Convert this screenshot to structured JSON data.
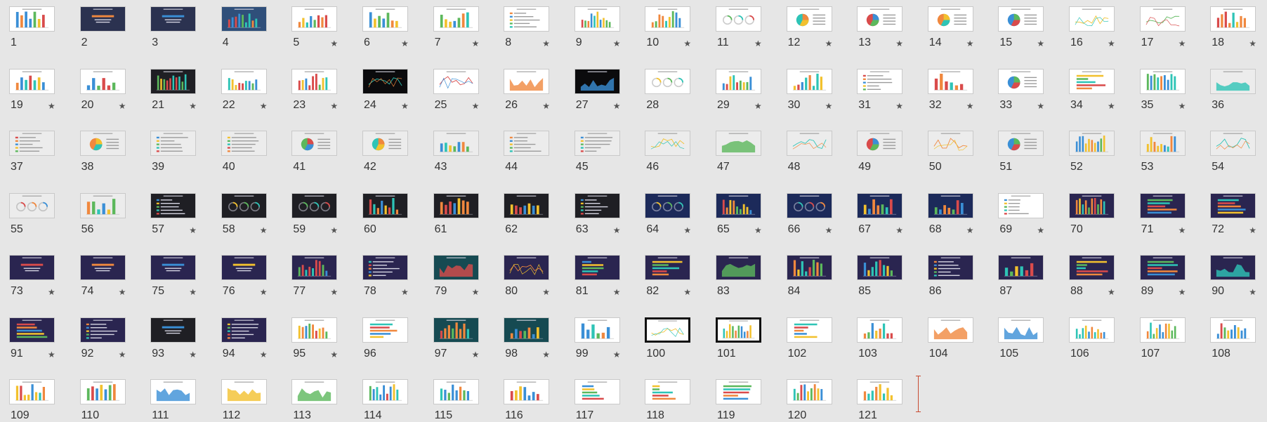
{
  "window": {
    "view": "Slide Sorter"
  },
  "theme_colors": {
    "light_bg": "#ffffff",
    "gray_bg": "#ececec",
    "dark_bg": "#1f1f24",
    "navy_bg": "#2b3250",
    "purple_bg": "#2a2550",
    "teal_bg": "#164a52",
    "accent_red": "#d94b4b",
    "accent_orange": "#f0883e",
    "accent_blue": "#3a8fd6",
    "accent_yellow": "#f2c12e",
    "accent_green": "#5cb85c",
    "accent_teal": "#2ec4b6"
  },
  "slides": [
    {
      "number": "1",
      "star": false,
      "bg": "light",
      "kind": "bars"
    },
    {
      "number": "2",
      "star": false,
      "bg": "navy",
      "kind": "title"
    },
    {
      "number": "3",
      "star": false,
      "bg": "navy",
      "kind": "title"
    },
    {
      "number": "4",
      "star": false,
      "bg": "blue",
      "kind": "bars"
    },
    {
      "number": "5",
      "star": true,
      "bg": "light",
      "kind": "bars"
    },
    {
      "number": "6",
      "star": true,
      "bg": "light",
      "kind": "bars"
    },
    {
      "number": "7",
      "star": true,
      "bg": "light",
      "kind": "bars"
    },
    {
      "number": "8",
      "star": true,
      "bg": "light",
      "kind": "list"
    },
    {
      "number": "9",
      "star": true,
      "bg": "light",
      "kind": "bars"
    },
    {
      "number": "10",
      "star": true,
      "bg": "light",
      "kind": "bars"
    },
    {
      "number": "11",
      "star": true,
      "bg": "light",
      "kind": "rings"
    },
    {
      "number": "12",
      "star": true,
      "bg": "light",
      "kind": "pie"
    },
    {
      "number": "13",
      "star": true,
      "bg": "light",
      "kind": "pie"
    },
    {
      "number": "14",
      "star": true,
      "bg": "light",
      "kind": "pie"
    },
    {
      "number": "15",
      "star": true,
      "bg": "light",
      "kind": "pie"
    },
    {
      "number": "16",
      "star": true,
      "bg": "light",
      "kind": "line"
    },
    {
      "number": "17",
      "star": true,
      "bg": "light",
      "kind": "line"
    },
    {
      "number": "18",
      "star": true,
      "bg": "light",
      "kind": "bars"
    },
    {
      "number": "19",
      "star": true,
      "bg": "light",
      "kind": "bars"
    },
    {
      "number": "20",
      "star": true,
      "bg": "light",
      "kind": "bars"
    },
    {
      "number": "21",
      "star": true,
      "bg": "dark",
      "kind": "bars"
    },
    {
      "number": "22",
      "star": true,
      "bg": "light",
      "kind": "bars"
    },
    {
      "number": "23",
      "star": true,
      "bg": "light",
      "kind": "bars"
    },
    {
      "number": "24",
      "star": true,
      "bg": "black",
      "kind": "line"
    },
    {
      "number": "25",
      "star": true,
      "bg": "light",
      "kind": "line"
    },
    {
      "number": "26",
      "star": true,
      "bg": "light",
      "kind": "area"
    },
    {
      "number": "27",
      "star": true,
      "bg": "black",
      "kind": "area"
    },
    {
      "number": "28",
      "star": false,
      "bg": "light",
      "kind": "rings"
    },
    {
      "number": "29",
      "star": true,
      "bg": "light",
      "kind": "bars"
    },
    {
      "number": "30",
      "star": true,
      "bg": "light",
      "kind": "bars"
    },
    {
      "number": "31",
      "star": true,
      "bg": "light",
      "kind": "list"
    },
    {
      "number": "32",
      "star": true,
      "bg": "light",
      "kind": "bars"
    },
    {
      "number": "33",
      "star": true,
      "bg": "light",
      "kind": "pie"
    },
    {
      "number": "34",
      "star": true,
      "bg": "light",
      "kind": "hbars"
    },
    {
      "number": "35",
      "star": true,
      "bg": "light",
      "kind": "bars"
    },
    {
      "number": "36",
      "star": false,
      "bg": "gray",
      "kind": "area"
    },
    {
      "number": "37",
      "star": false,
      "bg": "gray",
      "kind": "list"
    },
    {
      "number": "38",
      "star": false,
      "bg": "gray",
      "kind": "pie"
    },
    {
      "number": "39",
      "star": false,
      "bg": "gray",
      "kind": "list"
    },
    {
      "number": "40",
      "star": false,
      "bg": "gray",
      "kind": "list"
    },
    {
      "number": "41",
      "star": false,
      "bg": "gray",
      "kind": "pie"
    },
    {
      "number": "42",
      "star": false,
      "bg": "gray",
      "kind": "pie"
    },
    {
      "number": "43",
      "star": false,
      "bg": "gray",
      "kind": "bars"
    },
    {
      "number": "44",
      "star": false,
      "bg": "gray",
      "kind": "list"
    },
    {
      "number": "45",
      "star": false,
      "bg": "gray",
      "kind": "list"
    },
    {
      "number": "46",
      "star": false,
      "bg": "gray",
      "kind": "line"
    },
    {
      "number": "47",
      "star": false,
      "bg": "gray",
      "kind": "area"
    },
    {
      "number": "48",
      "star": false,
      "bg": "gray",
      "kind": "line"
    },
    {
      "number": "49",
      "star": false,
      "bg": "gray",
      "kind": "pie"
    },
    {
      "number": "50",
      "star": false,
      "bg": "gray",
      "kind": "line"
    },
    {
      "number": "51",
      "star": false,
      "bg": "gray",
      "kind": "pie"
    },
    {
      "number": "52",
      "star": false,
      "bg": "gray",
      "kind": "bars"
    },
    {
      "number": "53",
      "star": false,
      "bg": "gray",
      "kind": "bars"
    },
    {
      "number": "54",
      "star": false,
      "bg": "gray",
      "kind": "line"
    },
    {
      "number": "55",
      "star": false,
      "bg": "gray",
      "kind": "rings"
    },
    {
      "number": "56",
      "star": false,
      "bg": "gray",
      "kind": "bars"
    },
    {
      "number": "57",
      "star": true,
      "bg": "dark",
      "kind": "list"
    },
    {
      "number": "58",
      "star": true,
      "bg": "dark",
      "kind": "rings"
    },
    {
      "number": "59",
      "star": true,
      "bg": "dark",
      "kind": "rings"
    },
    {
      "number": "60",
      "star": false,
      "bg": "dark",
      "kind": "bars"
    },
    {
      "number": "61",
      "star": false,
      "bg": "dark",
      "kind": "bars"
    },
    {
      "number": "62",
      "star": false,
      "bg": "dark",
      "kind": "bars"
    },
    {
      "number": "63",
      "star": true,
      "bg": "dark",
      "kind": "list"
    },
    {
      "number": "64",
      "star": true,
      "bg": "space",
      "kind": "rings"
    },
    {
      "number": "65",
      "star": true,
      "bg": "space",
      "kind": "bars"
    },
    {
      "number": "66",
      "star": true,
      "bg": "space",
      "kind": "rings"
    },
    {
      "number": "67",
      "star": true,
      "bg": "space",
      "kind": "bars"
    },
    {
      "number": "68",
      "star": true,
      "bg": "space",
      "kind": "bars"
    },
    {
      "number": "69",
      "star": true,
      "bg": "light",
      "kind": "list"
    },
    {
      "number": "70",
      "star": false,
      "bg": "purple",
      "kind": "bars"
    },
    {
      "number": "71",
      "star": true,
      "bg": "purple",
      "kind": "hbars"
    },
    {
      "number": "72",
      "star": true,
      "bg": "purple",
      "kind": "hbars"
    },
    {
      "number": "73",
      "star": true,
      "bg": "purple",
      "kind": "title"
    },
    {
      "number": "74",
      "star": true,
      "bg": "purple",
      "kind": "title"
    },
    {
      "number": "75",
      "star": true,
      "bg": "purple",
      "kind": "title"
    },
    {
      "number": "76",
      "star": true,
      "bg": "purple",
      "kind": "title"
    },
    {
      "number": "77",
      "star": true,
      "bg": "purple",
      "kind": "bars"
    },
    {
      "number": "78",
      "star": true,
      "bg": "purple",
      "kind": "list"
    },
    {
      "number": "79",
      "star": true,
      "bg": "teal",
      "kind": "area"
    },
    {
      "number": "80",
      "star": true,
      "bg": "purple",
      "kind": "line"
    },
    {
      "number": "81",
      "star": true,
      "bg": "purple",
      "kind": "hbars"
    },
    {
      "number": "82",
      "star": true,
      "bg": "purple",
      "kind": "hbars"
    },
    {
      "number": "83",
      "star": false,
      "bg": "purple",
      "kind": "area"
    },
    {
      "number": "84",
      "star": false,
      "bg": "purple",
      "kind": "bars"
    },
    {
      "number": "85",
      "star": false,
      "bg": "purple",
      "kind": "bars"
    },
    {
      "number": "86",
      "star": false,
      "bg": "purple",
      "kind": "list"
    },
    {
      "number": "87",
      "star": false,
      "bg": "purple",
      "kind": "bars"
    },
    {
      "number": "88",
      "star": true,
      "bg": "purple",
      "kind": "hbars"
    },
    {
      "number": "89",
      "star": true,
      "bg": "purple",
      "kind": "hbars"
    },
    {
      "number": "90",
      "star": true,
      "bg": "purple",
      "kind": "area"
    },
    {
      "number": "91",
      "star": true,
      "bg": "purple",
      "kind": "hbars"
    },
    {
      "number": "92",
      "star": true,
      "bg": "purple",
      "kind": "list"
    },
    {
      "number": "93",
      "star": true,
      "bg": "dark",
      "kind": "title"
    },
    {
      "number": "94",
      "star": true,
      "bg": "purple",
      "kind": "list"
    },
    {
      "number": "95",
      "star": true,
      "bg": "light",
      "kind": "bars"
    },
    {
      "number": "96",
      "star": false,
      "bg": "light",
      "kind": "hbars"
    },
    {
      "number": "97",
      "star": true,
      "bg": "teal",
      "kind": "bars"
    },
    {
      "number": "98",
      "star": true,
      "bg": "teal",
      "kind": "bars"
    },
    {
      "number": "99",
      "star": true,
      "bg": "light",
      "kind": "bars"
    },
    {
      "number": "100",
      "star": false,
      "bg": "framed",
      "kind": "line"
    },
    {
      "number": "101",
      "star": false,
      "bg": "framed",
      "kind": "bars"
    },
    {
      "number": "102",
      "star": false,
      "bg": "light",
      "kind": "hbars"
    },
    {
      "number": "103",
      "star": false,
      "bg": "light",
      "kind": "bars"
    },
    {
      "number": "104",
      "star": false,
      "bg": "light",
      "kind": "area"
    },
    {
      "number": "105",
      "star": false,
      "bg": "light",
      "kind": "area"
    },
    {
      "number": "106",
      "star": false,
      "bg": "light",
      "kind": "bars"
    },
    {
      "number": "107",
      "star": false,
      "bg": "light",
      "kind": "bars"
    },
    {
      "number": "108",
      "star": false,
      "bg": "light",
      "kind": "bars"
    },
    {
      "number": "109",
      "star": false,
      "bg": "light",
      "kind": "bars"
    },
    {
      "number": "110",
      "star": false,
      "bg": "light",
      "kind": "bars"
    },
    {
      "number": "111",
      "star": false,
      "bg": "light",
      "kind": "area"
    },
    {
      "number": "112",
      "star": false,
      "bg": "light",
      "kind": "area"
    },
    {
      "number": "113",
      "star": false,
      "bg": "light",
      "kind": "area"
    },
    {
      "number": "114",
      "star": false,
      "bg": "light",
      "kind": "bars"
    },
    {
      "number": "115",
      "star": false,
      "bg": "light",
      "kind": "bars"
    },
    {
      "number": "116",
      "star": false,
      "bg": "light",
      "kind": "bars"
    },
    {
      "number": "117",
      "star": false,
      "bg": "light",
      "kind": "hbars"
    },
    {
      "number": "118",
      "star": false,
      "bg": "light",
      "kind": "hbars"
    },
    {
      "number": "119",
      "star": false,
      "bg": "light",
      "kind": "hbars"
    },
    {
      "number": "120",
      "star": false,
      "bg": "light",
      "kind": "bars"
    },
    {
      "number": "121",
      "star": false,
      "bg": "light",
      "kind": "bars"
    }
  ],
  "star_glyph": "★"
}
